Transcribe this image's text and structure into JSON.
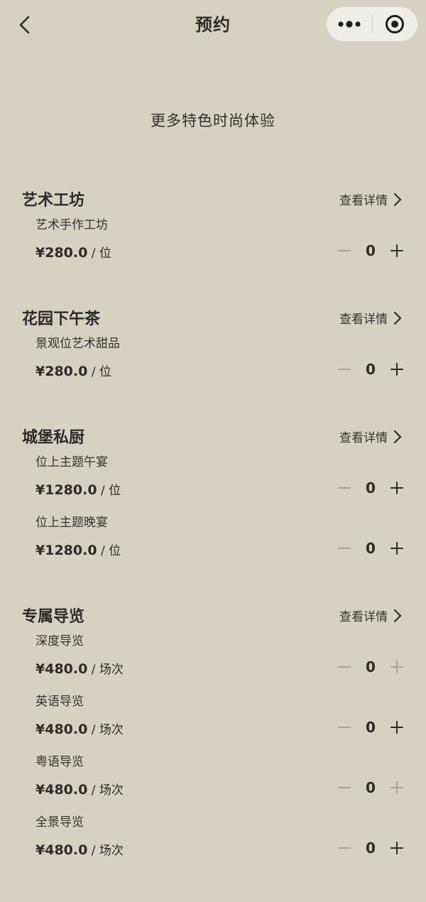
{
  "header": {
    "title": "预约",
    "back_icon": "chevron-left-icon",
    "more_icon": "more-dots-icon",
    "close_icon": "target-circle-icon"
  },
  "subtitle": "更多特色时尚体验",
  "details_label": "查看详情",
  "colors": {
    "background": "#d6d1c0",
    "text": "#2b2b2b",
    "capsule": "#efede8",
    "disabled": "#a9a596"
  },
  "sections": [
    {
      "title": "艺术工坊",
      "items": [
        {
          "name": "艺术手作工坊",
          "price": "¥280.0",
          "unit": " / 位",
          "qty": "0",
          "plus_enabled": true
        }
      ]
    },
    {
      "title": "花园下午茶",
      "items": [
        {
          "name": "景观位艺术甜品",
          "price": "¥280.0",
          "unit": " / 位",
          "qty": "0",
          "plus_enabled": true
        }
      ]
    },
    {
      "title": "城堡私厨",
      "items": [
        {
          "name": "位上主题午宴",
          "price": "¥1280.0",
          "unit": " / 位",
          "qty": "0",
          "plus_enabled": true
        },
        {
          "name": "位上主题晚宴",
          "price": "¥1280.0",
          "unit": " / 位",
          "qty": "0",
          "plus_enabled": true
        }
      ]
    },
    {
      "title": "专属导览",
      "items": [
        {
          "name": "深度导览",
          "price": "¥480.0",
          "unit": " / 场次",
          "qty": "0",
          "plus_enabled": false
        },
        {
          "name": "英语导览",
          "price": "¥480.0",
          "unit": " / 场次",
          "qty": "0",
          "plus_enabled": true
        },
        {
          "name": "粤语导览",
          "price": "¥480.0",
          "unit": " / 场次",
          "qty": "0",
          "plus_enabled": false
        },
        {
          "name": "全景导览",
          "price": "¥480.0",
          "unit": " / 场次",
          "qty": "0",
          "plus_enabled": true
        }
      ]
    }
  ]
}
